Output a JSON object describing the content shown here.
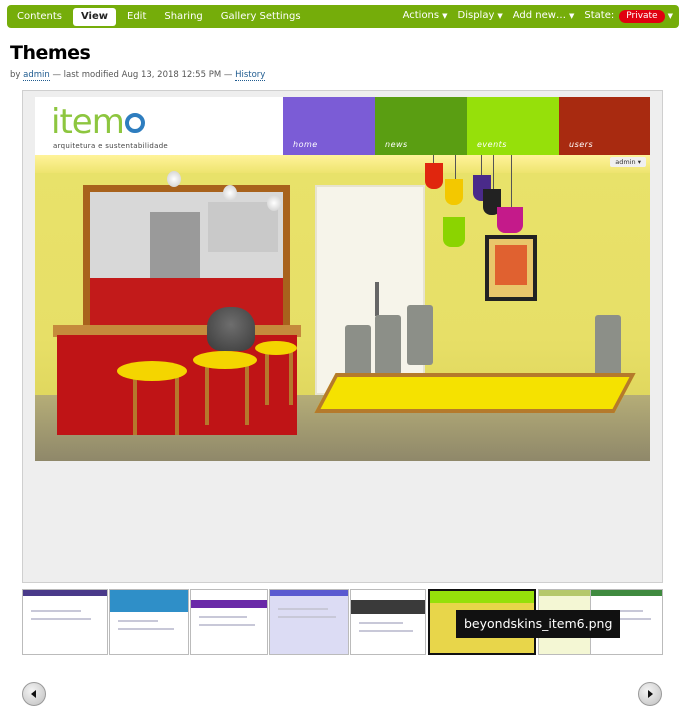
{
  "toolbar": {
    "tabs": [
      {
        "label": "Contents"
      },
      {
        "label": "View",
        "active": true
      },
      {
        "label": "Edit"
      },
      {
        "label": "Sharing"
      },
      {
        "label": "Gallery Settings"
      }
    ],
    "actions_label": "Actions",
    "display_label": "Display",
    "add_new_label": "Add new…",
    "state_label": "State:",
    "state_value": "Private",
    "colors": {
      "bar": "#75ad0a",
      "state_badge": "#e00010"
    }
  },
  "page": {
    "title": "Themes",
    "byline_by": "by",
    "author": "admin",
    "modified_text": "— last modified Aug 13, 2018 12:55 PM —",
    "history_link": "History"
  },
  "viewer": {
    "site_logo_text": "item",
    "site_tagline": "arquitetura e sustentabilidade",
    "site_nav": [
      {
        "label": "home",
        "color": "#7b5cd6"
      },
      {
        "label": "news",
        "color": "#5a9e12"
      },
      {
        "label": "events",
        "color": "#96e00a"
      },
      {
        "label": "users",
        "color": "#a82a10"
      }
    ],
    "admin_label": "admin ▾"
  },
  "thumbnails": {
    "tooltip": "beyondskins_item6.png",
    "items": [
      {
        "name": "thumb-1",
        "accent": "#4a3a8a"
      },
      {
        "name": "thumb-2",
        "accent": "#2f8fc8"
      },
      {
        "name": "thumb-3",
        "accent": "#6a2aa8"
      },
      {
        "name": "thumb-4",
        "accent": "#5a5ad0"
      },
      {
        "name": "thumb-5",
        "accent": "#3a3a3a"
      },
      {
        "name": "thumb-6",
        "accent": "#96e00a",
        "selected": true
      },
      {
        "name": "thumb-7",
        "accent": "#b5c86a"
      },
      {
        "name": "thumb-8",
        "accent": "#3f8a3f"
      }
    ]
  },
  "navigation": {
    "prev_icon": "prev-arrow-icon",
    "next_icon": "next-arrow-icon"
  }
}
